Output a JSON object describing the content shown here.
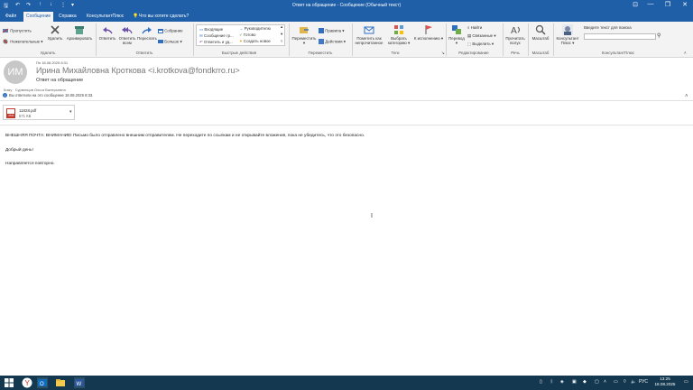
{
  "window": {
    "title": "Ответ на обращение  -  Сообщение (Обычный текст)",
    "controls": {
      "ribbon_opts": "⊡",
      "minimize": "—",
      "restore": "❐",
      "close": "✕"
    }
  },
  "menu": {
    "tabs": [
      "Файл",
      "Сообщение",
      "Справка",
      "КонсультантПлюс"
    ],
    "tell_me": "Что вы хотите сделать?"
  },
  "ribbon": {
    "delete": {
      "ignore": "Пропустить",
      "junk": "Нежелательные",
      "delete": "Удалить",
      "archive": "Архивировать",
      "group": "Удалить"
    },
    "respond": {
      "reply": "Ответить",
      "reply_all_1": "Ответить",
      "reply_all_2": "всем",
      "forward": "Переслать",
      "meeting": "Собрание",
      "more": "Больше",
      "group": "Ответить"
    },
    "quick_steps": {
      "items": [
        "Входящие",
        "Сообщение гр...",
        "Ответить и уд...",
        "Руководителю",
        "Готово",
        "Создать новое"
      ],
      "group": "Быстрые действия"
    },
    "move": {
      "move": "Переместить",
      "rules": "Правила",
      "actions": "Действия",
      "group": "Переместить"
    },
    "tags": {
      "mark_unread_1": "Пометить как",
      "mark_unread_2": "непрочитанное",
      "categorize_1": "Выбрать",
      "categorize_2": "категорию",
      "followup": "К исполнению",
      "group": "Теги"
    },
    "editing": {
      "translate": "Перевод",
      "find": "Найти",
      "related": "Связанные",
      "select": "Выделить",
      "group": "Редактирование"
    },
    "speech": {
      "read_1": "Прочитать",
      "read_2": "вслух",
      "group": "Речь"
    },
    "zoom": {
      "label": "Масштаб",
      "group": "Масштаб"
    },
    "consultant": {
      "label_1": "Консультант",
      "label_2": "Плюс",
      "search_label": "Введите текст для поиска",
      "group": "КонсультантПлюс"
    }
  },
  "message": {
    "avatar_initials": "ИМ",
    "date": "Пн 18.08.2025 8:31",
    "sender": "Ирина Михайловна Кроткова <i.krotkova@fondkrro.ru>",
    "subject": "Ответ на обращение",
    "to_label": "Кому",
    "to_value": "Сурвенцов Ольга Валерьевна",
    "replied_note": "Вы ответили на это сообщение 18.08.2025 8:33.",
    "attachment": {
      "name": "11828.pdf",
      "size": "571 КБ",
      "type": "PDF"
    },
    "body": [
      "ВНЕШНЯЯ ПОЧТА: ВНИМАНИЕ! Письмо было отправлено внешним отправителем. Не переходите по ссылкам и не открывайте вложения, пока не убедитесь, что это безопасно.",
      "Добрый день!",
      "Направляется повторно."
    ]
  },
  "taskbar": {
    "clock_time": "13:25",
    "clock_date": "18.08.2025",
    "lang": "РУС"
  },
  "colors": {
    "titlebar": "#1f5fa8",
    "taskbar": "#14384f",
    "ribbon": "#f3f3f3"
  }
}
